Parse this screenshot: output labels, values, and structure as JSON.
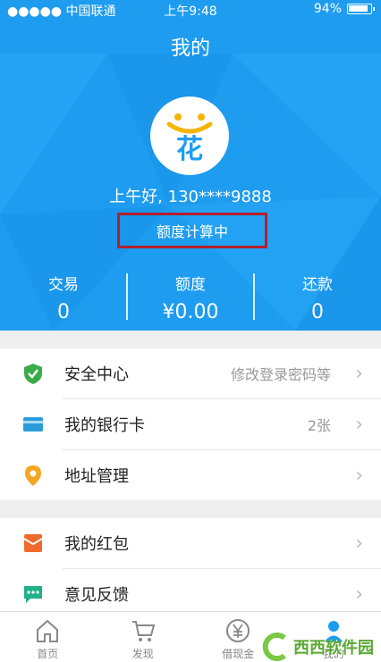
{
  "status_bar": {
    "carrier": "●●●●● 中国联通",
    "time": "上午9:48",
    "battery": "94%"
  },
  "header": {
    "title": "我的",
    "greeting": "上午好, 130****9888",
    "quota_status": "额度计算中"
  },
  "stats": [
    {
      "label": "交易",
      "value": "0"
    },
    {
      "label": "额度",
      "value": "¥0.00"
    },
    {
      "label": "还款",
      "value": "0"
    }
  ],
  "menu": [
    {
      "label": "安全中心",
      "sub": "修改登录密码等",
      "icon": "shield-icon"
    },
    {
      "label": "我的银行卡",
      "sub": "2张",
      "icon": "bank-card-icon"
    },
    {
      "label": "地址管理",
      "sub": "",
      "icon": "location-pin-icon"
    },
    {
      "label": "我的红包",
      "sub": "",
      "icon": "red-packet-icon"
    },
    {
      "label": "意见反馈",
      "sub": "",
      "icon": "feedback-icon"
    }
  ],
  "tabs": [
    {
      "label": "首页"
    },
    {
      "label": "发现"
    },
    {
      "label": "借现金"
    },
    {
      "label": "我的"
    }
  ],
  "avatar_glyph": "花",
  "watermark": "西西软件园",
  "colors": {
    "primary": "#1e9cf0",
    "highlight_border": "#b2202a",
    "safe_green": "#3bab4a",
    "card_blue": "#2a9cd8",
    "pin_orange": "#f5a623",
    "packet_orange": "#ef6a2b",
    "feedback_teal": "#23b08a"
  }
}
